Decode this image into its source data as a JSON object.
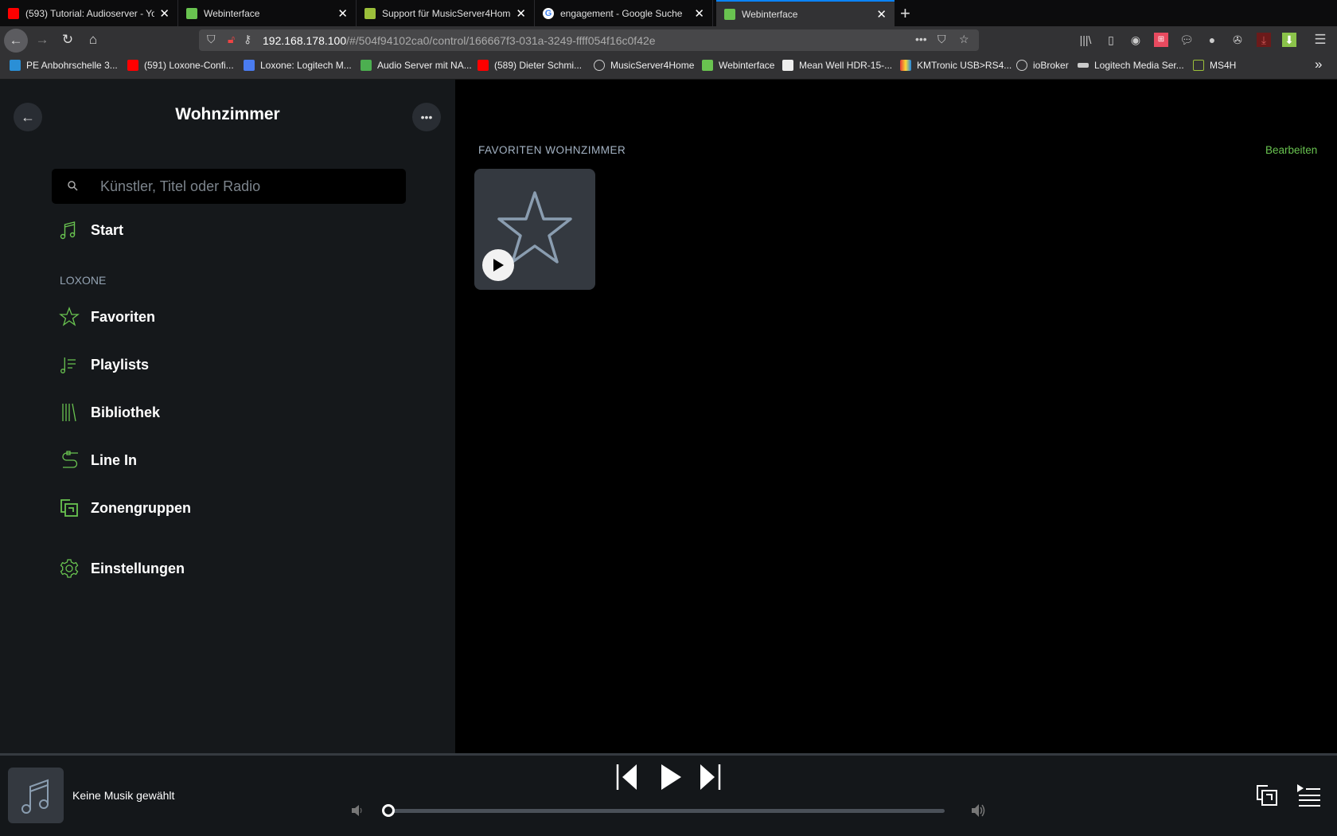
{
  "browser": {
    "tabs": [
      {
        "title": "(593) Tutorial: Audioserver - YouTube",
        "favicon": "youtube-icon",
        "color": "#ff0000"
      },
      {
        "title": "Webinterface",
        "favicon": "loxone-icon",
        "color": "#69c350"
      },
      {
        "title": "Support für MusicServer4Home",
        "favicon": "musicserver-icon",
        "color": "#9bbf3a"
      },
      {
        "title": "engagement - Google Suche",
        "favicon": "google-icon",
        "color": "#4285f4"
      },
      {
        "title": "Webinterface",
        "favicon": "loxone-icon",
        "color": "#69c350",
        "active": true
      }
    ],
    "url_host": "192.168.178.100",
    "url_path": "/#/504f94102ca0/control/166667f3-031a-3249-ffff054f16c0f42e",
    "bookmarks": [
      {
        "label": "PE Anbohrschelle 3...",
        "color": "#2a8fd6"
      },
      {
        "label": "(591) Loxone-Confi...",
        "color": "#ff0000"
      },
      {
        "label": "Loxone: Logitech M...",
        "color": "#4a7cf0"
      },
      {
        "label": "Audio Server mit NA...",
        "color": "#4caf50"
      },
      {
        "label": "(589) Dieter Schmi...",
        "color": "#ff0000"
      },
      {
        "label": "MusicServer4Home",
        "color": "#888888"
      },
      {
        "label": "Webinterface",
        "color": "#69c350"
      },
      {
        "label": "Mean Well HDR-15-...",
        "color": "#eeeeee"
      },
      {
        "label": "KMTronic USB>RS4...",
        "color": "#e53935"
      },
      {
        "label": "ioBroker",
        "color": "#888888"
      },
      {
        "label": "Logitech Media Ser...",
        "color": "#cccccc"
      },
      {
        "label": "MS4H",
        "color": "#9bbf3a"
      }
    ]
  },
  "sidebar": {
    "room": "Wohnzimmer",
    "search_placeholder": "Künstler, Titel oder Radio",
    "start": "Start",
    "section": "LOXONE",
    "items": [
      "Favoriten",
      "Playlists",
      "Bibliothek",
      "Line In",
      "Zonengruppen"
    ],
    "settings": "Einstellungen"
  },
  "main": {
    "title": "FAVORITEN WOHNZIMMER",
    "edit": "Bearbeiten"
  },
  "player": {
    "now_playing": "Keine Musik gewählt",
    "volume": 0
  },
  "colors": {
    "accent": "#69c350"
  }
}
